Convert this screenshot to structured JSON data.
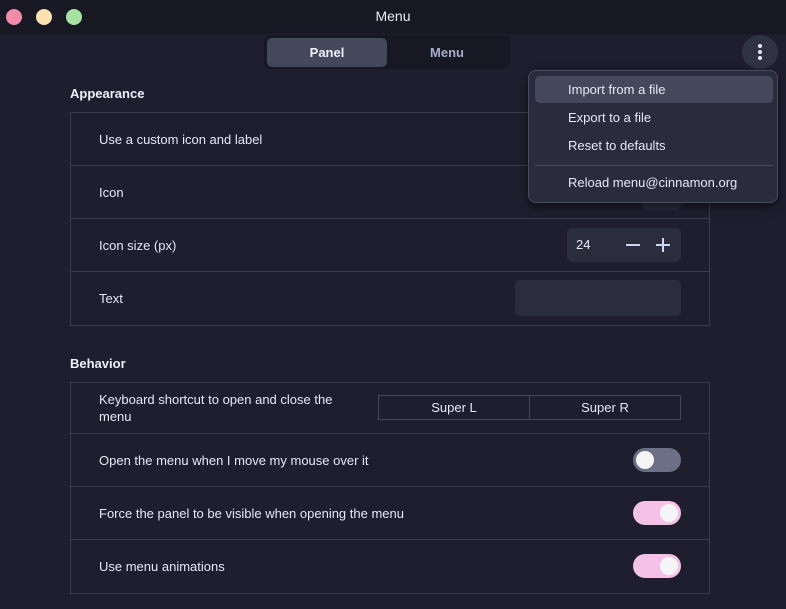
{
  "window": {
    "title": "Menu"
  },
  "tabs": [
    {
      "label": "Panel",
      "active": true
    },
    {
      "label": "Menu",
      "active": false
    }
  ],
  "menu_button": {
    "icon": "kebab-vertical-icon"
  },
  "popover": {
    "items": [
      {
        "label": "Import from a file",
        "hovered": true
      },
      {
        "label": "Export to a file"
      },
      {
        "label": "Reset to defaults"
      },
      {
        "label": "Reload menu@cinnamon.org"
      }
    ]
  },
  "appearance": {
    "title": "Appearance",
    "custom_icon_label": "Use a custom icon and label",
    "icon_label": "Icon",
    "icon_size_label": "Icon size (px)",
    "icon_size_value": "24",
    "text_label": "Text",
    "text_value": ""
  },
  "behavior": {
    "title": "Behavior",
    "shortcut_label": "Keyboard shortcut to open and close the menu",
    "shortcut_primary": "Super L",
    "shortcut_secondary": "Super R",
    "hover_open_label": "Open the menu when I move my mouse over it",
    "hover_open_enabled": false,
    "force_panel_label": "Force the panel to be visible when opening the menu",
    "force_panel_enabled": true,
    "animations_label": "Use menu animations",
    "animations_enabled": true
  },
  "colors": {
    "background": "#1e1e2e",
    "accent_toggle_on": "#f5c2e7",
    "toggle_off": "#6c6f85",
    "close": "#f38ba8",
    "minimize": "#f9e2af",
    "maximize": "#a6e3a1"
  }
}
